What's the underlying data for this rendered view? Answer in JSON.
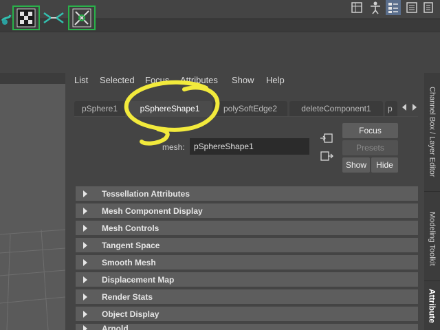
{
  "menu": [
    "List",
    "Selected",
    "Focus",
    "Attributes",
    "Show",
    "Help"
  ],
  "tabs": [
    "pSphere1",
    "pSphereShape1",
    "polySoftEdge2",
    "deleteComponent1",
    "p"
  ],
  "active_tab_index": 1,
  "mesh": {
    "label": "mesh:",
    "value": "pSphereShape1"
  },
  "buttons": {
    "focus": "Focus",
    "presets": "Presets",
    "show": "Show",
    "hide": "Hide"
  },
  "sections": [
    "Tessellation Attributes",
    "Mesh Component Display",
    "Mesh Controls",
    "Tangent Space",
    "Smooth Mesh",
    "Displacement Map",
    "Render Stats",
    "Object Display",
    "Arnold"
  ],
  "dock_tabs": [
    "Channel Box / Layer Editor",
    "Modeling Toolkit",
    "Attribute"
  ],
  "colors": {
    "annotation": "#f2ea3c",
    "shelf_selected": "#29b24a"
  }
}
